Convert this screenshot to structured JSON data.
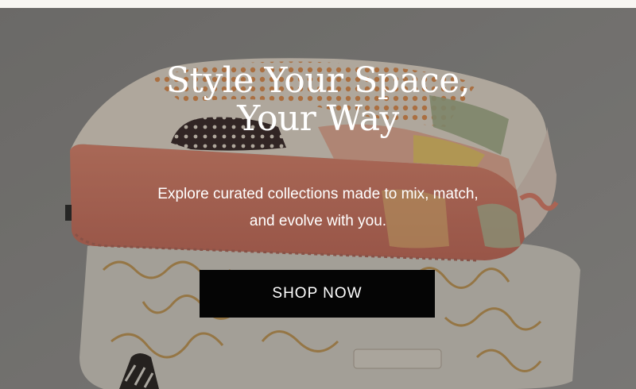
{
  "hero": {
    "headline_line1": "Style Your Space,",
    "headline_line2": "Your Way",
    "subtext_line1": "Explore curated collections made to mix, match,",
    "subtext_line2": "and evolve with you.",
    "cta_label": "SHOP NOW",
    "colors": {
      "text": "#ffffff",
      "button_bg": "#050505",
      "cushion_coral": "#e9856f",
      "cushion_cream": "#efe4d6",
      "pattern_orange": "#e8863c",
      "line_gold": "#c9984e"
    }
  }
}
